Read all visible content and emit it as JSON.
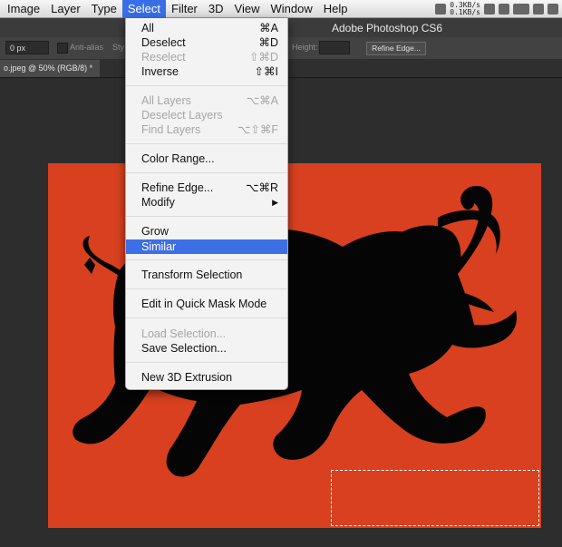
{
  "menubar": {
    "items": [
      "Image",
      "Layer",
      "Type",
      "Select",
      "Filter",
      "3D",
      "View",
      "Window",
      "Help"
    ],
    "active_index": 3,
    "net_up": "0.3KB/s",
    "net_down": "0.1KB/s"
  },
  "app": {
    "title": "Adobe Photoshop CS6"
  },
  "options": {
    "feather_value": "0 px",
    "antialias_label": "Anti-alias",
    "style_label": "Sty",
    "height_label": "Height:",
    "refine_edge_button": "Refine Edge..."
  },
  "document": {
    "tab_label": "o.jpeg @ 50% (RGB/8) *"
  },
  "select_menu": {
    "all": {
      "label": "All",
      "shortcut": "⌘A"
    },
    "deselect": {
      "label": "Deselect",
      "shortcut": "⌘D"
    },
    "reselect": {
      "label": "Reselect",
      "shortcut": "⇧⌘D"
    },
    "inverse": {
      "label": "Inverse",
      "shortcut": "⇧⌘I"
    },
    "all_layers": {
      "label": "All Layers",
      "shortcut": "⌥⌘A"
    },
    "deselect_layers": {
      "label": "Deselect Layers",
      "shortcut": ""
    },
    "find_layers": {
      "label": "Find Layers",
      "shortcut": "⌥⇧⌘F"
    },
    "color_range": {
      "label": "Color Range...",
      "shortcut": ""
    },
    "refine_edge": {
      "label": "Refine Edge...",
      "shortcut": "⌥⌘R"
    },
    "modify": {
      "label": "Modify",
      "shortcut": "▶"
    },
    "grow": {
      "label": "Grow",
      "shortcut": ""
    },
    "similar": {
      "label": "Similar",
      "shortcut": ""
    },
    "transform_selection": {
      "label": "Transform Selection",
      "shortcut": ""
    },
    "quick_mask": {
      "label": "Edit in Quick Mask Mode",
      "shortcut": ""
    },
    "load_selection": {
      "label": "Load Selection...",
      "shortcut": ""
    },
    "save_selection": {
      "label": "Save Selection...",
      "shortcut": ""
    },
    "new_3d_extrusion": {
      "label": "New 3D Extrusion",
      "shortcut": ""
    }
  },
  "colors": {
    "canvas_background": "#d8401f",
    "silhouette": "#050505",
    "menu_highlight": "#3d6fe6"
  }
}
